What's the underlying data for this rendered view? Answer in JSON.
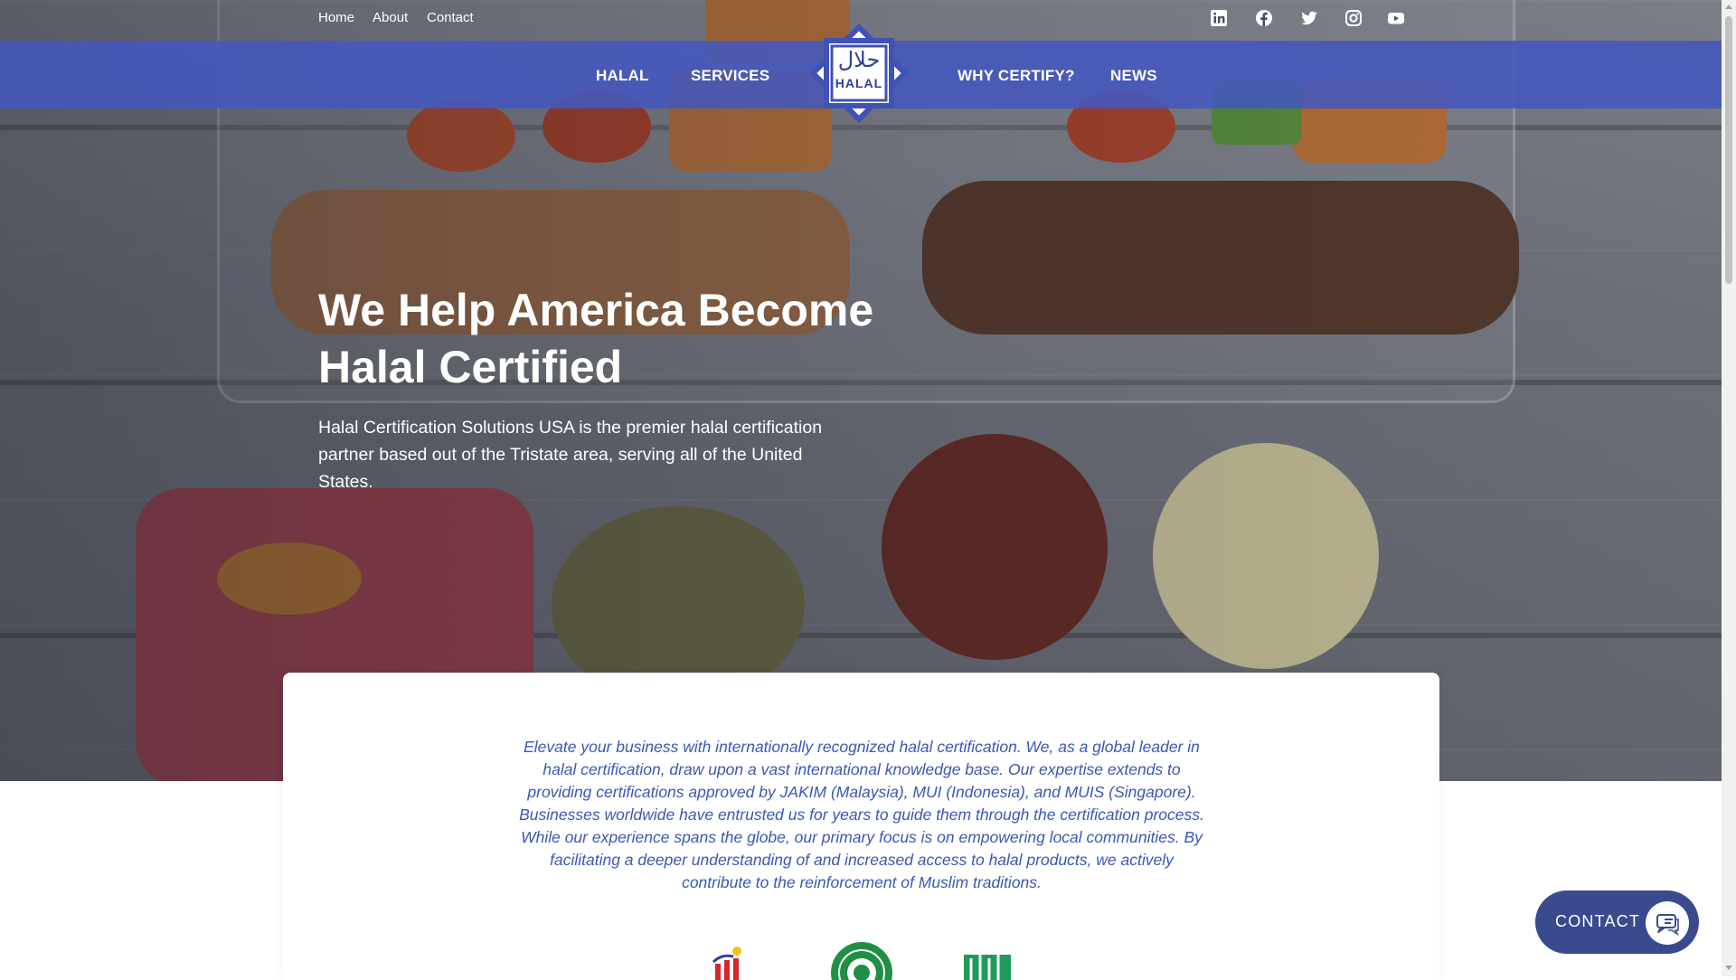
{
  "topbar": {
    "links": [
      "Home",
      "About",
      "Contact"
    ],
    "social": [
      "linkedin-icon",
      "facebook-icon",
      "twitter-icon",
      "instagram-icon",
      "youtube-icon"
    ]
  },
  "nav": {
    "left": [
      "HALAL",
      "SERVICES"
    ],
    "right": [
      "WHY CERTIFY?",
      "NEWS"
    ],
    "logo_arabic": "حلال",
    "logo_text": "HALAL"
  },
  "hero": {
    "headline_line1": "We Help America Become",
    "headline_line2": "Halal Certified",
    "lead": "Halal Certification Solutions USA is the premier halal certification partner based out of the Tristate area, serving all of the United States."
  },
  "intro": {
    "text": "Elevate your business with internationally recognized halal certification. We, as a global leader in halal certification, draw upon a vast international knowledge base. Our expertise extends to providing certifications approved by JAKIM (Malaysia), MUI (Indonesia), and MUIS (Singapore). Businesses worldwide have entrusted us for years to guide them through the certification process. While our experience spans the globe, our primary focus is on empowering local communities. By facilitating a deeper understanding of and increased access to halal products, we actively contribute to the reinforcement of Muslim traditions."
  },
  "certifications": [
    "jakim-logo",
    "mui-logo",
    "muis-logo"
  ],
  "contact_button": {
    "label": "CONTACT",
    "icon": "chat-icon"
  },
  "colors": {
    "nav_blue": "#4458be",
    "text_blue": "#3b57b8",
    "contact_bg": "#3a4a8e"
  }
}
